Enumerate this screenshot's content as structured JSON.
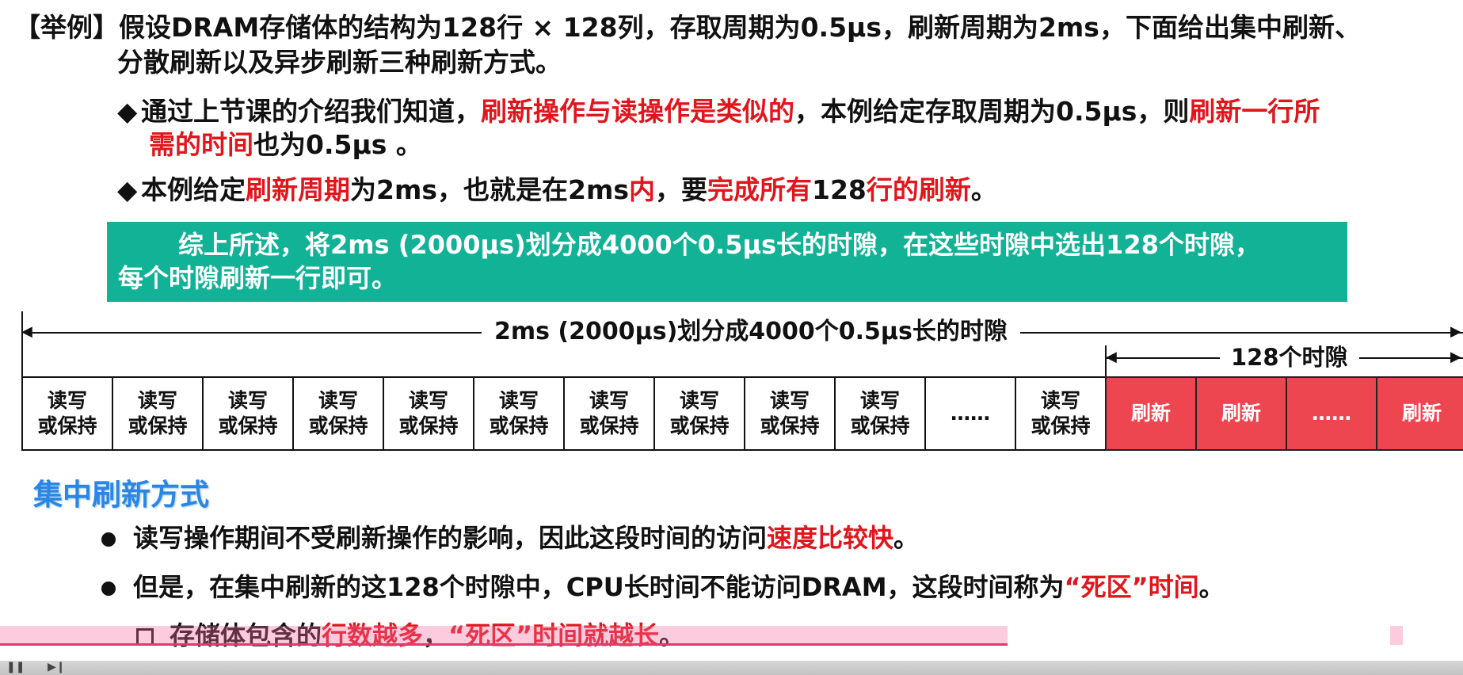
{
  "title": {
    "tag": "【举例】",
    "line1_text": "假设DRAM存储体的结构为128行 × 128列，存取周期为0.5μs，刷新周期为2ms，下面给出集中刷新、",
    "line2_text": "分散刷新以及异步刷新三种刷新方式。"
  },
  "bullets": [
    {
      "p1": "通过上节课的介绍我们知道，",
      "p2_red": "刷新操作与读操作是类似的",
      "p3": "，本例给定存取周期为0.5μs，则",
      "p4_red": "刷新一行所",
      "p5_red": "需的时间",
      "p6": "也为0.5μs 。"
    },
    {
      "p1": "本例给定",
      "p2_red": "刷新周期",
      "p3": "为2ms，也就是在2ms",
      "p4_red": "内",
      "p5": "，要",
      "p6_red": "完成所有",
      "p7": "128",
      "p8_red": "行的刷新",
      "p9": "。"
    }
  ],
  "summary": {
    "line1": "综上所述，将2ms (2000μs)划分成4000个0.5μs长的时隙，在这些时隙中选出128个时隙，",
    "line2": "每个时隙刷新一行即可。"
  },
  "diagram": {
    "top_label": "2ms (2000μs)划分成4000个0.5μs长的时隙",
    "sub_label": "128个时隙",
    "slots": [
      {
        "text1": "读写",
        "text2": "或保持",
        "kind": "rw"
      },
      {
        "text1": "读写",
        "text2": "或保持",
        "kind": "rw"
      },
      {
        "text1": "读写",
        "text2": "或保持",
        "kind": "rw"
      },
      {
        "text1": "读写",
        "text2": "或保持",
        "kind": "rw"
      },
      {
        "text1": "读写",
        "text2": "或保持",
        "kind": "rw"
      },
      {
        "text1": "读写",
        "text2": "或保持",
        "kind": "rw"
      },
      {
        "text1": "读写",
        "text2": "或保持",
        "kind": "rw"
      },
      {
        "text1": "读写",
        "text2": "或保持",
        "kind": "rw"
      },
      {
        "text1": "读写",
        "text2": "或保持",
        "kind": "rw"
      },
      {
        "text1": "读写",
        "text2": "或保持",
        "kind": "rw"
      },
      {
        "text1": "……",
        "text2": "",
        "kind": "rw"
      },
      {
        "text1": "读写",
        "text2": "或保持",
        "kind": "rw"
      },
      {
        "text1": "刷新",
        "text2": "",
        "kind": "refresh"
      },
      {
        "text1": "刷新",
        "text2": "",
        "kind": "refresh"
      },
      {
        "text1": "……",
        "text2": "",
        "kind": "refresh"
      },
      {
        "text1": "刷新",
        "text2": "",
        "kind": "refresh"
      }
    ]
  },
  "section": {
    "title": "集中刷新方式",
    "point1_a": "读写操作期间不受刷新操作的影响，因此这段时间的访问",
    "point1_red": "速度比较快",
    "point1_b": "。",
    "point2_a": "但是，在集中刷新的这128个时隙中，CPU长时间不能访问DRAM，这段时间称为",
    "point2_red": "“死区”时间",
    "point2_b": "。",
    "sub_a": "存储体包含的",
    "sub_red1": "行数越多",
    "sub_b": "，",
    "sub_red2": "“死区”时间就越长",
    "sub_c": "。"
  },
  "colors": {
    "accent_red": "#e1161c",
    "summary_bg": "#12b296",
    "refresh_bg": "#ee4650",
    "section_blue": "#2b86e3"
  }
}
